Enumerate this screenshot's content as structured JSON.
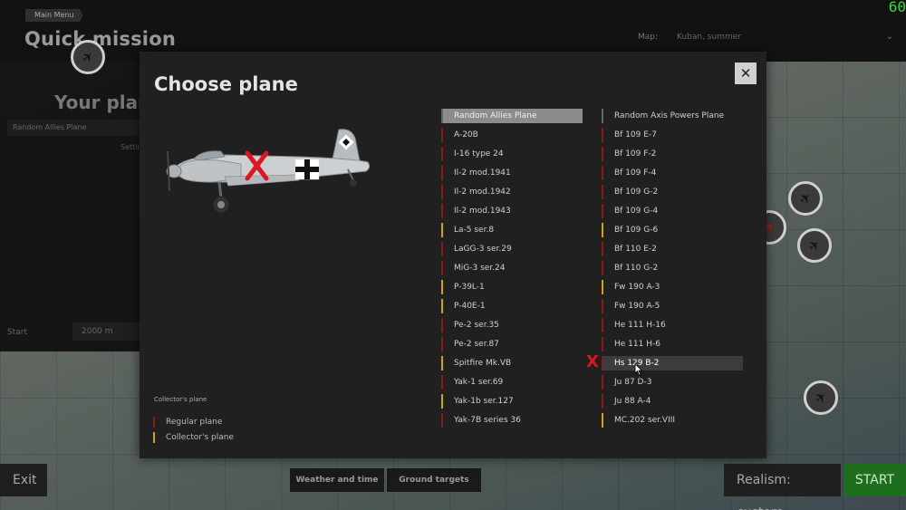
{
  "header": {
    "breadcrumb": "Main Menu",
    "title": "Quick mission",
    "fps": "60",
    "map_label": "Map:",
    "map_value": "Kuban, summer"
  },
  "left_panel": {
    "title": "Your planes",
    "plane_field": "Random Allies Plane",
    "settings": "Settings",
    "start_label": "Start",
    "start_value": "2000 m"
  },
  "bottom": {
    "exit": "Exit",
    "weather": "Weather and time",
    "ground_targets": "Ground targets",
    "realism": "Realism: custom",
    "start": "START"
  },
  "modal": {
    "title": "Choose plane",
    "close": "✕",
    "legend_title": "Collector's plane",
    "legend": [
      {
        "label": "Regular plane",
        "color": "#8b1a1a"
      },
      {
        "label": "Collector's plane",
        "color": "#d4a20e"
      }
    ],
    "allies": [
      {
        "name": "Random Allies Plane",
        "type": "random",
        "selected": true
      },
      {
        "name": "A-20B",
        "type": "regular"
      },
      {
        "name": "I-16 type 24",
        "type": "regular"
      },
      {
        "name": "Il-2 mod.1941",
        "type": "regular"
      },
      {
        "name": "Il-2 mod.1942",
        "type": "regular"
      },
      {
        "name": "Il-2 mod.1943",
        "type": "regular"
      },
      {
        "name": "La-5 ser.8",
        "type": "collector"
      },
      {
        "name": "LaGG-3 ser.29",
        "type": "regular"
      },
      {
        "name": "MiG-3 ser.24",
        "type": "regular"
      },
      {
        "name": "P-39L-1",
        "type": "collector"
      },
      {
        "name": "P-40E-1",
        "type": "collector"
      },
      {
        "name": "Pe-2 ser.35",
        "type": "regular"
      },
      {
        "name": "Pe-2 ser.87",
        "type": "regular"
      },
      {
        "name": "Spitfire Mk.VB",
        "type": "collector"
      },
      {
        "name": "Yak-1 ser.69",
        "type": "regular"
      },
      {
        "name": "Yak-1b ser.127",
        "type": "collector"
      },
      {
        "name": "Yak-7B series 36",
        "type": "regular"
      }
    ],
    "axis": [
      {
        "name": "Random Axis Powers Plane",
        "type": "random"
      },
      {
        "name": "Bf 109 E-7",
        "type": "regular"
      },
      {
        "name": "Bf 109 F-2",
        "type": "regular"
      },
      {
        "name": "Bf 109 F-4",
        "type": "regular"
      },
      {
        "name": "Bf 109 G-2",
        "type": "regular"
      },
      {
        "name": "Bf 109 G-4",
        "type": "regular"
      },
      {
        "name": "Bf 109 G-6",
        "type": "collector"
      },
      {
        "name": "Bf 110 E-2",
        "type": "regular"
      },
      {
        "name": "Bf 110 G-2",
        "type": "regular"
      },
      {
        "name": "Fw 190 A-3",
        "type": "collector"
      },
      {
        "name": "Fw 190 A-5",
        "type": "regular"
      },
      {
        "name": "He 111 H-16",
        "type": "regular"
      },
      {
        "name": "He 111 H-6",
        "type": "regular"
      },
      {
        "name": "Hs 129 B-2",
        "type": "regular",
        "hover": true
      },
      {
        "name": "Ju 87 D-3",
        "type": "regular"
      },
      {
        "name": "Ju 88 A-4",
        "type": "regular"
      },
      {
        "name": "MC.202 ser.VIII",
        "type": "collector"
      }
    ],
    "annotation_mark": "X"
  },
  "colors": {
    "regular": "#8b1a1a",
    "collector": "#d4a20e",
    "random": "#666666",
    "start_green": "#1d6e1d",
    "mark_red": "#e0141e"
  }
}
